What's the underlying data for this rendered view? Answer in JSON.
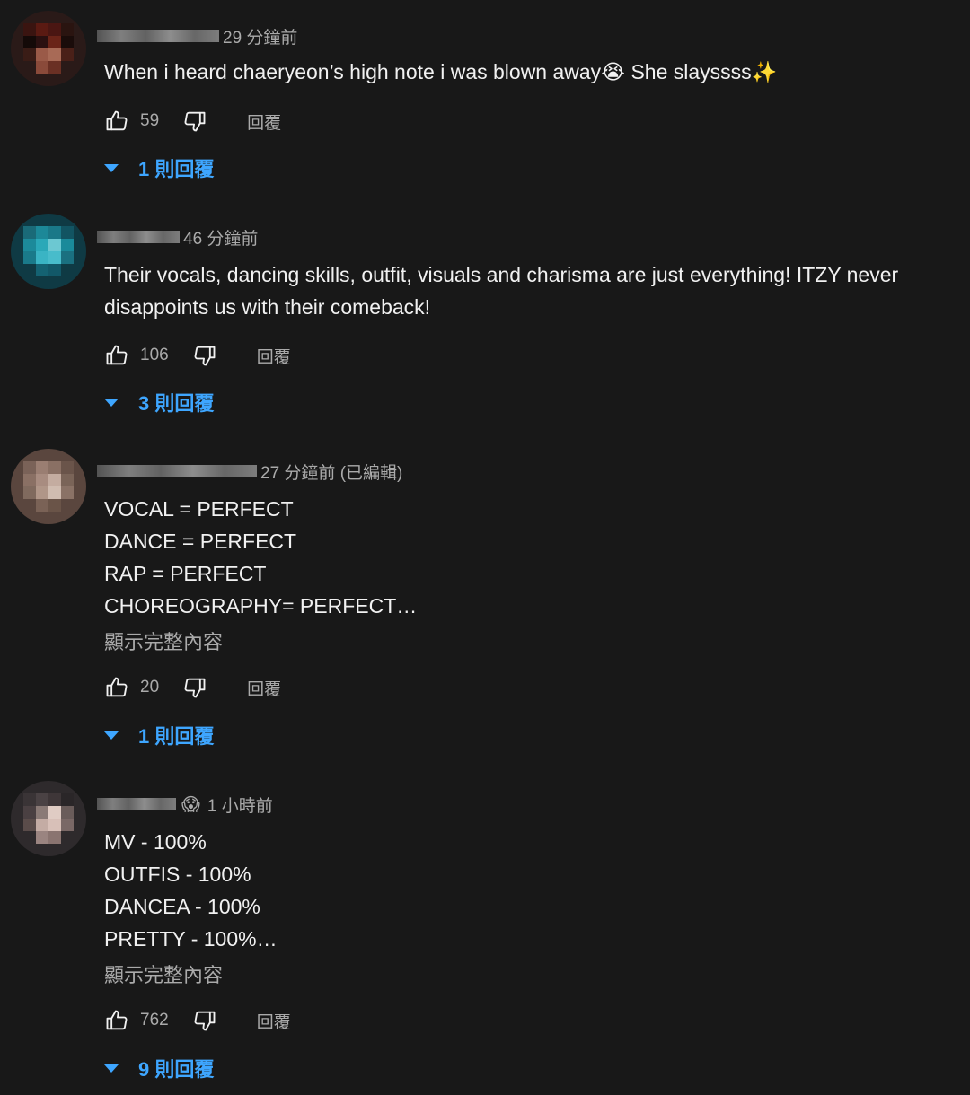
{
  "comments": [
    {
      "time": "29 分鐘前",
      "text": "When i heard chaeryeon’s high note i was blown away😭 She slayssss✨",
      "likes": "59",
      "reply_label": "回覆",
      "replies_label": "1 則回覆"
    },
    {
      "time": "46 分鐘前",
      "text": "Their vocals, dancing skills, outfit, visuals and charisma are just everything! ITZY never disappoints us with their comeback!",
      "likes": "106",
      "reply_label": "回覆",
      "replies_label": "3 則回覆"
    },
    {
      "time": "27 分鐘前 (已編輯)",
      "text": "VOCAL = PERFECT\nDANCE = PERFECT\nRAP = PERFECT\nCHOREOGRAPHY= PERFECT…",
      "show_more": "顯示完整內容",
      "likes": "20",
      "reply_label": "回覆",
      "replies_label": "1 則回覆"
    },
    {
      "name_emoji": "😱",
      "time": "1 小時前",
      "text": "MV - 100%\nOUTFIS - 100%\nDANCEA - 100%\nPRETTY - 100%…",
      "show_more": "顯示完整內容",
      "likes": "762",
      "reply_label": "回覆",
      "replies_label": "9 則回覆"
    }
  ],
  "icons": {
    "like": "thumbs-up-icon",
    "dislike": "thumbs-down-icon",
    "expand": "caret-down-icon"
  },
  "colors": {
    "background": "#181818",
    "link": "#3ea6ff",
    "secondary_text": "#aaaaaa"
  }
}
